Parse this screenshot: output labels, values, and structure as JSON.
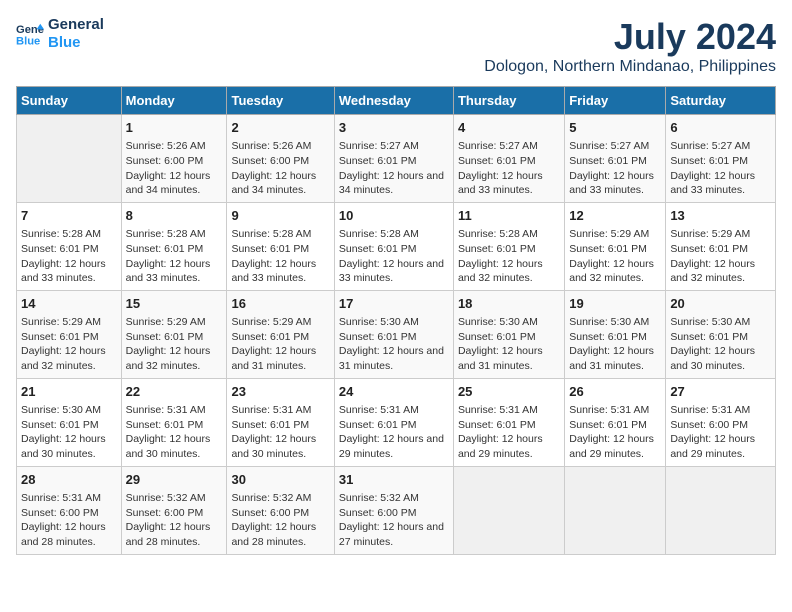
{
  "logo": {
    "line1": "General",
    "line2": "Blue"
  },
  "title": "July 2024",
  "subtitle": "Dologon, Northern Mindanao, Philippines",
  "days_header": [
    "Sunday",
    "Monday",
    "Tuesday",
    "Wednesday",
    "Thursday",
    "Friday",
    "Saturday"
  ],
  "weeks": [
    [
      {
        "day": "",
        "sunrise": "",
        "sunset": "",
        "daylight": ""
      },
      {
        "day": "1",
        "sunrise": "Sunrise: 5:26 AM",
        "sunset": "Sunset: 6:00 PM",
        "daylight": "Daylight: 12 hours and 34 minutes."
      },
      {
        "day": "2",
        "sunrise": "Sunrise: 5:26 AM",
        "sunset": "Sunset: 6:00 PM",
        "daylight": "Daylight: 12 hours and 34 minutes."
      },
      {
        "day": "3",
        "sunrise": "Sunrise: 5:27 AM",
        "sunset": "Sunset: 6:01 PM",
        "daylight": "Daylight: 12 hours and 34 minutes."
      },
      {
        "day": "4",
        "sunrise": "Sunrise: 5:27 AM",
        "sunset": "Sunset: 6:01 PM",
        "daylight": "Daylight: 12 hours and 33 minutes."
      },
      {
        "day": "5",
        "sunrise": "Sunrise: 5:27 AM",
        "sunset": "Sunset: 6:01 PM",
        "daylight": "Daylight: 12 hours and 33 minutes."
      },
      {
        "day": "6",
        "sunrise": "Sunrise: 5:27 AM",
        "sunset": "Sunset: 6:01 PM",
        "daylight": "Daylight: 12 hours and 33 minutes."
      }
    ],
    [
      {
        "day": "7",
        "sunrise": "Sunrise: 5:28 AM",
        "sunset": "Sunset: 6:01 PM",
        "daylight": "Daylight: 12 hours and 33 minutes."
      },
      {
        "day": "8",
        "sunrise": "Sunrise: 5:28 AM",
        "sunset": "Sunset: 6:01 PM",
        "daylight": "Daylight: 12 hours and 33 minutes."
      },
      {
        "day": "9",
        "sunrise": "Sunrise: 5:28 AM",
        "sunset": "Sunset: 6:01 PM",
        "daylight": "Daylight: 12 hours and 33 minutes."
      },
      {
        "day": "10",
        "sunrise": "Sunrise: 5:28 AM",
        "sunset": "Sunset: 6:01 PM",
        "daylight": "Daylight: 12 hours and 33 minutes."
      },
      {
        "day": "11",
        "sunrise": "Sunrise: 5:28 AM",
        "sunset": "Sunset: 6:01 PM",
        "daylight": "Daylight: 12 hours and 32 minutes."
      },
      {
        "day": "12",
        "sunrise": "Sunrise: 5:29 AM",
        "sunset": "Sunset: 6:01 PM",
        "daylight": "Daylight: 12 hours and 32 minutes."
      },
      {
        "day": "13",
        "sunrise": "Sunrise: 5:29 AM",
        "sunset": "Sunset: 6:01 PM",
        "daylight": "Daylight: 12 hours and 32 minutes."
      }
    ],
    [
      {
        "day": "14",
        "sunrise": "Sunrise: 5:29 AM",
        "sunset": "Sunset: 6:01 PM",
        "daylight": "Daylight: 12 hours and 32 minutes."
      },
      {
        "day": "15",
        "sunrise": "Sunrise: 5:29 AM",
        "sunset": "Sunset: 6:01 PM",
        "daylight": "Daylight: 12 hours and 32 minutes."
      },
      {
        "day": "16",
        "sunrise": "Sunrise: 5:29 AM",
        "sunset": "Sunset: 6:01 PM",
        "daylight": "Daylight: 12 hours and 31 minutes."
      },
      {
        "day": "17",
        "sunrise": "Sunrise: 5:30 AM",
        "sunset": "Sunset: 6:01 PM",
        "daylight": "Daylight: 12 hours and 31 minutes."
      },
      {
        "day": "18",
        "sunrise": "Sunrise: 5:30 AM",
        "sunset": "Sunset: 6:01 PM",
        "daylight": "Daylight: 12 hours and 31 minutes."
      },
      {
        "day": "19",
        "sunrise": "Sunrise: 5:30 AM",
        "sunset": "Sunset: 6:01 PM",
        "daylight": "Daylight: 12 hours and 31 minutes."
      },
      {
        "day": "20",
        "sunrise": "Sunrise: 5:30 AM",
        "sunset": "Sunset: 6:01 PM",
        "daylight": "Daylight: 12 hours and 30 minutes."
      }
    ],
    [
      {
        "day": "21",
        "sunrise": "Sunrise: 5:30 AM",
        "sunset": "Sunset: 6:01 PM",
        "daylight": "Daylight: 12 hours and 30 minutes."
      },
      {
        "day": "22",
        "sunrise": "Sunrise: 5:31 AM",
        "sunset": "Sunset: 6:01 PM",
        "daylight": "Daylight: 12 hours and 30 minutes."
      },
      {
        "day": "23",
        "sunrise": "Sunrise: 5:31 AM",
        "sunset": "Sunset: 6:01 PM",
        "daylight": "Daylight: 12 hours and 30 minutes."
      },
      {
        "day": "24",
        "sunrise": "Sunrise: 5:31 AM",
        "sunset": "Sunset: 6:01 PM",
        "daylight": "Daylight: 12 hours and 29 minutes."
      },
      {
        "day": "25",
        "sunrise": "Sunrise: 5:31 AM",
        "sunset": "Sunset: 6:01 PM",
        "daylight": "Daylight: 12 hours and 29 minutes."
      },
      {
        "day": "26",
        "sunrise": "Sunrise: 5:31 AM",
        "sunset": "Sunset: 6:01 PM",
        "daylight": "Daylight: 12 hours and 29 minutes."
      },
      {
        "day": "27",
        "sunrise": "Sunrise: 5:31 AM",
        "sunset": "Sunset: 6:00 PM",
        "daylight": "Daylight: 12 hours and 29 minutes."
      }
    ],
    [
      {
        "day": "28",
        "sunrise": "Sunrise: 5:31 AM",
        "sunset": "Sunset: 6:00 PM",
        "daylight": "Daylight: 12 hours and 28 minutes."
      },
      {
        "day": "29",
        "sunrise": "Sunrise: 5:32 AM",
        "sunset": "Sunset: 6:00 PM",
        "daylight": "Daylight: 12 hours and 28 minutes."
      },
      {
        "day": "30",
        "sunrise": "Sunrise: 5:32 AM",
        "sunset": "Sunset: 6:00 PM",
        "daylight": "Daylight: 12 hours and 28 minutes."
      },
      {
        "day": "31",
        "sunrise": "Sunrise: 5:32 AM",
        "sunset": "Sunset: 6:00 PM",
        "daylight": "Daylight: 12 hours and 27 minutes."
      },
      {
        "day": "",
        "sunrise": "",
        "sunset": "",
        "daylight": ""
      },
      {
        "day": "",
        "sunrise": "",
        "sunset": "",
        "daylight": ""
      },
      {
        "day": "",
        "sunrise": "",
        "sunset": "",
        "daylight": ""
      }
    ]
  ]
}
